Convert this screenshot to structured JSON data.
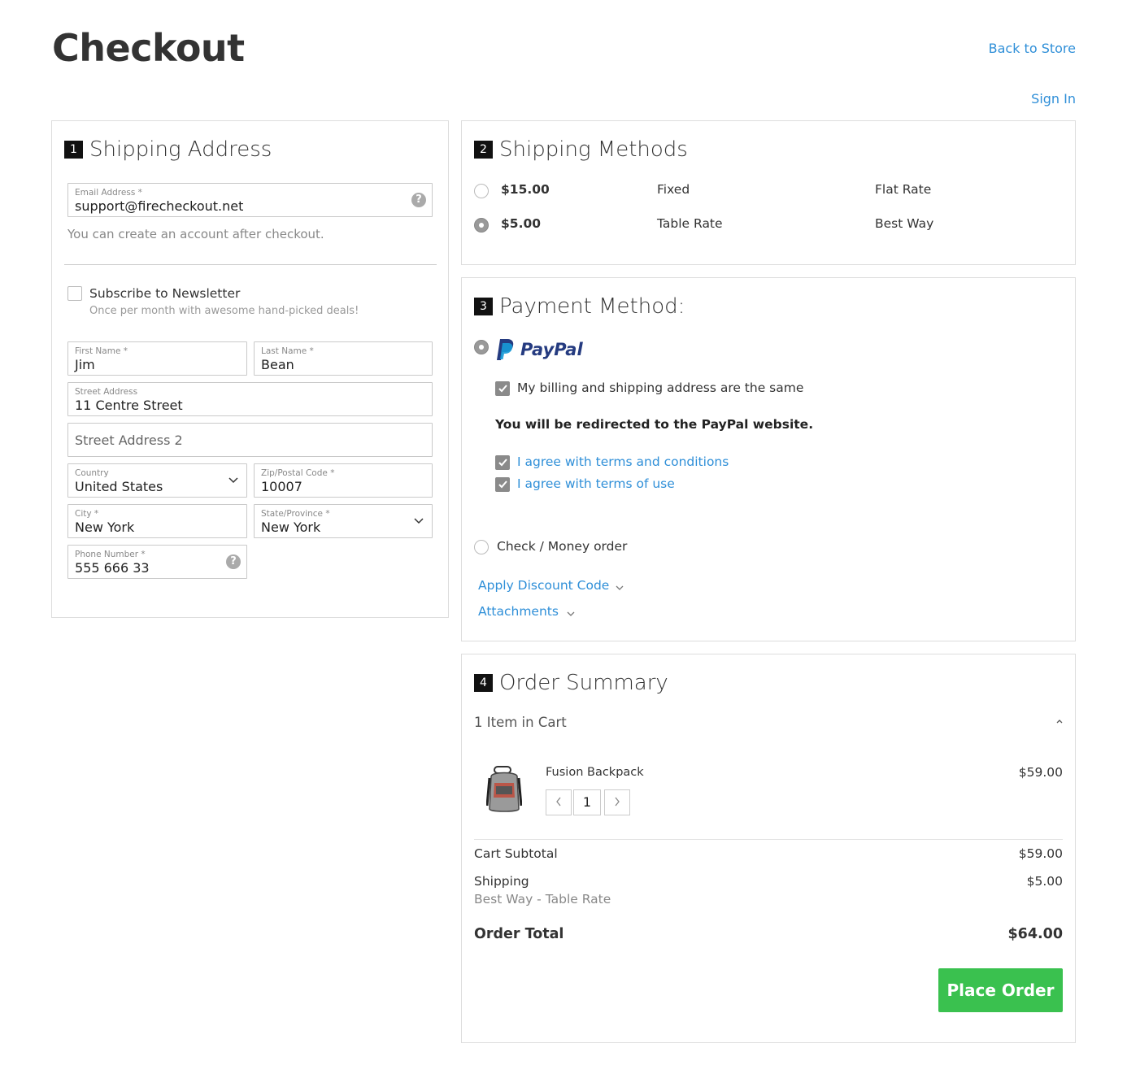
{
  "header": {
    "title": "Checkout",
    "back_link": "Back to Store",
    "signin_link": "Sign In"
  },
  "shipping_address": {
    "step": "1",
    "title": "Shipping Address",
    "email": {
      "label": "Email Address *",
      "value": "support@firecheckout.net"
    },
    "email_note": "You can create an account after checkout.",
    "newsletter": {
      "label": "Subscribe to Newsletter",
      "note": "Once per month with awesome hand-picked deals!",
      "checked": false
    },
    "first_name": {
      "label": "First Name *",
      "value": "Jim"
    },
    "last_name": {
      "label": "Last Name *",
      "value": "Bean"
    },
    "street": {
      "label": "Street Address",
      "value": "11 Centre Street"
    },
    "street2": {
      "placeholder": "Street Address 2"
    },
    "country": {
      "label": "Country",
      "value": "United States"
    },
    "zip": {
      "label": "Zip/Postal Code *",
      "value": "10007"
    },
    "city": {
      "label": "City *",
      "value": "New York"
    },
    "state": {
      "label": "State/Province *",
      "value": "New York"
    },
    "phone": {
      "label": "Phone Number *",
      "value": "555 666 33"
    }
  },
  "shipping_methods": {
    "step": "2",
    "title": "Shipping Methods",
    "options": [
      {
        "price": "$15.00",
        "method": "Fixed",
        "carrier": "Flat Rate",
        "selected": false
      },
      {
        "price": "$5.00",
        "method": "Table Rate",
        "carrier": "Best Way",
        "selected": true
      }
    ]
  },
  "payment": {
    "step": "3",
    "title": "Payment Method:",
    "paypal_logo_text": "PayPal",
    "same_address": "My billing and shipping address are the same",
    "redirect_note": "You will be redirected to the PayPal website.",
    "agree_terms": "I agree with terms and conditions",
    "agree_use": "I agree with terms of use",
    "check_money": "Check / Money order",
    "discount": "Apply Discount Code",
    "attachments": "Attachments"
  },
  "order_summary": {
    "step": "4",
    "title": "Order Summary",
    "items_count": "1 Item in Cart",
    "item": {
      "name": "Fusion Backpack",
      "price": "$59.00",
      "qty": "1"
    },
    "subtotal_label": "Cart Subtotal",
    "subtotal_value": "$59.00",
    "shipping_label": "Shipping",
    "shipping_method": "Best Way - Table Rate",
    "shipping_value": "$5.00",
    "total_label": "Order Total",
    "total_value": "$64.00",
    "place_order": "Place Order"
  },
  "colors": {
    "link": "#2f8fd8",
    "place_order": "#3ac14f",
    "paypal_dark": "#253b80",
    "paypal_light": "#179bd7"
  }
}
